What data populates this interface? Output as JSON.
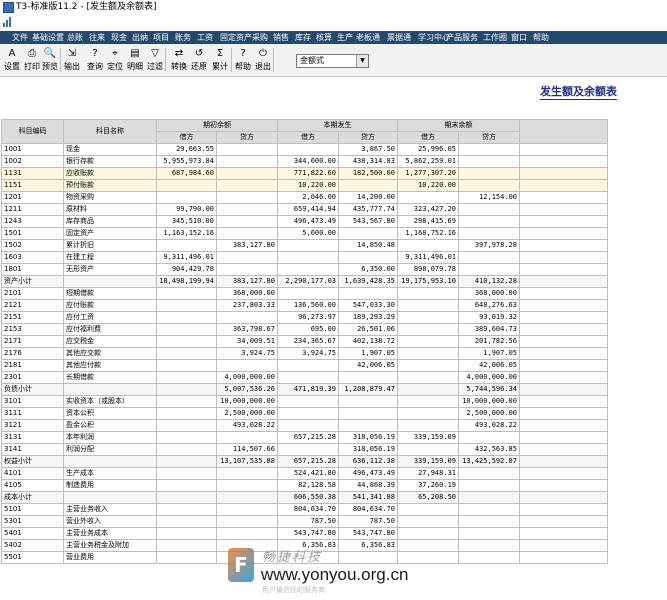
{
  "window": {
    "title": "T3-标准版11.2 - [发生额及余额表]"
  },
  "menu": [
    "文件",
    "基础设置",
    "总账",
    "往来",
    "现金",
    "出纳",
    "项目",
    "账务",
    "工资",
    "固定资产",
    "采购",
    "销售",
    "库存",
    "核算",
    "生产",
    "老板通",
    "票据通",
    "学习中心",
    "产品服务",
    "工作圈",
    "窗口",
    "帮助"
  ],
  "toolbar": {
    "buttons": [
      {
        "label": "设置",
        "icon": "settings-icon",
        "glyph": "A"
      },
      {
        "label": "打印",
        "icon": "print-icon",
        "glyph": "⎙"
      },
      {
        "label": "预览",
        "icon": "preview-icon",
        "glyph": "🔍"
      },
      {
        "label": "输出",
        "icon": "export-icon",
        "glyph": "⇲"
      },
      {
        "label": "查询",
        "icon": "query-icon",
        "glyph": "?"
      },
      {
        "label": "定位",
        "icon": "locate-icon",
        "glyph": "⌖"
      },
      {
        "label": "明细",
        "icon": "detail-icon",
        "glyph": "▤"
      },
      {
        "label": "过滤",
        "icon": "filter-icon",
        "glyph": "▽"
      },
      {
        "label": "转换",
        "icon": "convert-icon",
        "glyph": "⇄"
      },
      {
        "label": "还原",
        "icon": "restore-icon",
        "glyph": "↺"
      },
      {
        "label": "累计",
        "icon": "sum-icon",
        "glyph": "Σ"
      },
      {
        "label": "帮助",
        "icon": "help-icon",
        "glyph": "?"
      },
      {
        "label": "退出",
        "icon": "exit-icon",
        "glyph": "⏻"
      }
    ],
    "format_select": {
      "value": "金额式"
    }
  },
  "report": {
    "title": "发生额及余额表",
    "headers": {
      "code": "科目编码",
      "name": "科目名称",
      "opening": "期初余额",
      "period": "本期发生",
      "closing": "期末余额",
      "debit": "借方",
      "credit": "贷方"
    },
    "rows": [
      [
        "1001",
        "现金",
        "29,663.55",
        "",
        "",
        "3,867.50",
        "25,996.05",
        "",
        ""
      ],
      [
        "1002",
        "银行存款",
        "5,955,973.84",
        "",
        "344,600.00",
        "438,314.83",
        "5,862,259.01",
        "",
        ""
      ],
      [
        "1131",
        "应收账款",
        "687,984.60",
        "",
        "771,822.60",
        "182,500.00",
        "1,277,307.20",
        "",
        "hl"
      ],
      [
        "1151",
        "预付账款",
        "",
        "",
        "10,220.00",
        "",
        "10,220.00",
        "",
        "hl"
      ],
      [
        "1201",
        "物资采购",
        "",
        "",
        "2,046.00",
        "14,200.00",
        "",
        "12,154.00",
        ""
      ],
      [
        "1211",
        "原材料",
        "99,790.00",
        "",
        "659,414.94",
        "435,777.74",
        "323,427.20",
        "",
        ""
      ],
      [
        "1243",
        "库存商品",
        "345,510.00",
        "",
        "496,473.49",
        "543,567.80",
        "298,415.69",
        "",
        ""
      ],
      [
        "1501",
        "固定资产",
        "1,163,152.16",
        "",
        "5,600.00",
        "",
        "1,168,752.16",
        "",
        ""
      ],
      [
        "1502",
        "累计折旧",
        "",
        "383,127.80",
        "",
        "14,850.48",
        "",
        "397,978.28",
        ""
      ],
      [
        "1603",
        "在建工程",
        "9,311,496.01",
        "",
        "",
        "",
        "9,311,496.01",
        "",
        ""
      ],
      [
        "1801",
        "无形资产",
        "904,429.78",
        "",
        "",
        "6,350.00",
        "898,079.78",
        "",
        ""
      ],
      [
        "资产小计",
        "",
        "18,498,199.94",
        "383,127.80",
        "2,290,177.03",
        "1,639,428.35",
        "19,175,953.10",
        "410,132.28",
        "sub"
      ],
      [
        "2101",
        "短期借款",
        "",
        "368,000.00",
        "",
        "",
        "",
        "368,000.00",
        ""
      ],
      [
        "2121",
        "应付账款",
        "",
        "237,803.33",
        "136,560.00",
        "547,033.30",
        "",
        "648,276.63",
        ""
      ],
      [
        "2151",
        "应付工资",
        "",
        "",
        "96,273.97",
        "189,293.29",
        "",
        "93,019.32",
        ""
      ],
      [
        "2153",
        "应付福利费",
        "",
        "363,798.67",
        "695.00",
        "26,501.06",
        "",
        "389,604.73",
        ""
      ],
      [
        "2171",
        "应交税金",
        "",
        "34,009.51",
        "234,365.67",
        "402,138.72",
        "",
        "201,782.56",
        ""
      ],
      [
        "2176",
        "其他应交款",
        "",
        "3,924.75",
        "3,924.75",
        "1,907.05",
        "",
        "1,907.05",
        ""
      ],
      [
        "2181",
        "其他应付款",
        "",
        "",
        "",
        "42,006.05",
        "",
        "42,006.05",
        ""
      ],
      [
        "2301",
        "长期借款",
        "",
        "4,000,000.00",
        "",
        "",
        "",
        "4,000,000.00",
        ""
      ],
      [
        "负债小计",
        "",
        "",
        "5,007,536.26",
        "471,819.39",
        "1,208,879.47",
        "",
        "5,744,596.34",
        "sub"
      ],
      [
        "3101",
        "实收资本（或股本）",
        "",
        "10,000,000.00",
        "",
        "",
        "",
        "10,000,000.00",
        ""
      ],
      [
        "3111",
        "资本公积",
        "",
        "2,500,000.00",
        "",
        "",
        "",
        "2,500,000.00",
        ""
      ],
      [
        "3121",
        "盈余公积",
        "",
        "493,028.22",
        "",
        "",
        "",
        "493,028.22",
        ""
      ],
      [
        "3131",
        "本年利润",
        "",
        "",
        "657,215.28",
        "318,056.19",
        "339,159.09",
        "",
        ""
      ],
      [
        "3141",
        "利润分配",
        "",
        "114,507.66",
        "",
        "318,056.19",
        "",
        "432,563.85",
        ""
      ],
      [
        "权益小计",
        "",
        "",
        "13,107,535.88",
        "657,215.28",
        "636,112.38",
        "339,159.09",
        "13,425,592.07",
        "sub"
      ],
      [
        "4101",
        "生产成本",
        "",
        "",
        "524,421.80",
        "496,473.49",
        "27,948.31",
        "",
        ""
      ],
      [
        "4105",
        "制造费用",
        "",
        "",
        "82,128.58",
        "44,868.39",
        "37,260.19",
        "",
        ""
      ],
      [
        "成本小计",
        "",
        "",
        "",
        "606,550.38",
        "541,341.88",
        "65,208.50",
        "",
        "sub"
      ],
      [
        "5101",
        "主营业务收入",
        "",
        "",
        "804,634.70",
        "804,634.70",
        "",
        "",
        ""
      ],
      [
        "5301",
        "营业外收入",
        "",
        "",
        "787.50",
        "787.50",
        "",
        "",
        ""
      ],
      [
        "5401",
        "主营业务成本",
        "",
        "",
        "543,747.80",
        "543,747.80",
        "",
        "",
        ""
      ],
      [
        "5402",
        "主营业务税金及附加",
        "",
        "",
        "6,356.83",
        "6,356.83",
        "",
        "",
        ""
      ],
      [
        "5501",
        "营业费用",
        "",
        "",
        "",
        "",
        "",
        "",
        ""
      ]
    ]
  },
  "watermark": {
    "logo_letter": "F",
    "brand_cn": "畅捷科技",
    "url": "www.yonyou.org.cn",
    "subtitle": "用户最信任的服务商"
  }
}
